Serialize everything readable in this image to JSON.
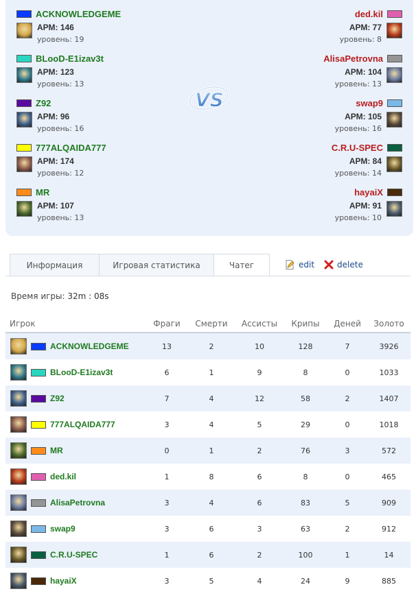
{
  "team_left": [
    {
      "name": "ACKNOWLEDGEME",
      "color": "#0a3cff",
      "apm": "АРМ: 146",
      "level": "уровень: 19",
      "avatar_color": "#d4a84a",
      "avatar_icon": "hero-portrait-icon"
    },
    {
      "name": "BLooD-E1izav3t",
      "color": "#2ad6c0",
      "apm": "АРМ: 123",
      "level": "уровень: 13",
      "avatar_color": "#2e7a8a",
      "avatar_icon": "hero-portrait-icon"
    },
    {
      "name": "Z92",
      "color": "#5a0aa0",
      "apm": "АРМ: 96",
      "level": "уровень: 16",
      "avatar_color": "#3d5f8a",
      "avatar_icon": "hero-portrait-icon"
    },
    {
      "name": "777ALQAIDA777",
      "color": "#ffff00",
      "apm": "АРМ: 174",
      "level": "уровень: 12",
      "avatar_color": "#8a5a4a",
      "avatar_icon": "hero-portrait-icon"
    },
    {
      "name": "MR",
      "color": "#ff8c1a",
      "apm": "АРМ: 107",
      "level": "уровень: 13",
      "avatar_color": "#4a6a2a",
      "avatar_icon": "hero-portrait-icon"
    }
  ],
  "team_right": [
    {
      "name": "ded.kil",
      "color": "#e060b0",
      "apm": "АРМ: 77",
      "level": "уровень: 8",
      "avatar_color": "#b83a1a",
      "avatar_icon": "hero-portrait-icon"
    },
    {
      "name": "AlisaPetrovna",
      "color": "#959595",
      "apm": "АРМ: 104",
      "level": "уровень: 13",
      "avatar_color": "#6a7aa0",
      "avatar_icon": "hero-portrait-icon"
    },
    {
      "name": "swap9",
      "color": "#7ab8e8",
      "apm": "АРМ: 105",
      "level": "уровень: 16",
      "avatar_color": "#5a4a3a",
      "avatar_icon": "hero-portrait-icon"
    },
    {
      "name": "C.R.U-SPEC",
      "color": "#0a6040",
      "apm": "АРМ: 84",
      "level": "уровень: 14",
      "avatar_color": "#6a5a2a",
      "avatar_icon": "hero-portrait-icon"
    },
    {
      "name": "hayaiX",
      "color": "#4a2a0a",
      "apm": "АРМ: 91",
      "level": "уровень: 10",
      "avatar_color": "#4a5a6a",
      "avatar_icon": "hero-portrait-icon"
    }
  ],
  "vs_label": "VS",
  "tabs": [
    {
      "label": "Информация"
    },
    {
      "label": "Игровая статистика"
    },
    {
      "label": "Чатег"
    }
  ],
  "actions": {
    "edit": "edit",
    "delete": "delete"
  },
  "game_time": {
    "label": "Время игры:",
    "value": "32m : 08s"
  },
  "table": {
    "headers": [
      "Игрок",
      "Фраги",
      "Смерти",
      "Ассисты",
      "Крипы",
      "Деней",
      "Золото"
    ],
    "rows": [
      {
        "name": "ACKNOWLEDGEME",
        "color": "#0a3cff",
        "avatar_color": "#d4a84a",
        "cells": [
          "13",
          "2",
          "10",
          "128",
          "7",
          "3926"
        ]
      },
      {
        "name": "BLooD-E1izav3t",
        "color": "#2ad6c0",
        "avatar_color": "#2e7a8a",
        "cells": [
          "6",
          "1",
          "9",
          "8",
          "0",
          "1033"
        ]
      },
      {
        "name": "Z92",
        "color": "#5a0aa0",
        "avatar_color": "#3d5f8a",
        "cells": [
          "7",
          "4",
          "12",
          "58",
          "2",
          "1407"
        ]
      },
      {
        "name": "777ALQAIDA777",
        "color": "#ffff00",
        "avatar_color": "#8a5a4a",
        "cells": [
          "3",
          "4",
          "5",
          "29",
          "0",
          "1018"
        ]
      },
      {
        "name": "MR",
        "color": "#ff8c1a",
        "avatar_color": "#4a6a2a",
        "cells": [
          "0",
          "1",
          "2",
          "76",
          "3",
          "572"
        ]
      },
      {
        "name": "ded.kil",
        "color": "#e060b0",
        "avatar_color": "#b83a1a",
        "cells": [
          "1",
          "8",
          "6",
          "8",
          "0",
          "465"
        ]
      },
      {
        "name": "AlisaPetrovna",
        "color": "#959595",
        "avatar_color": "#6a7aa0",
        "cells": [
          "3",
          "4",
          "6",
          "83",
          "5",
          "909"
        ]
      },
      {
        "name": "swap9",
        "color": "#7ab8e8",
        "avatar_color": "#5a4a3a",
        "cells": [
          "3",
          "6",
          "3",
          "63",
          "2",
          "912"
        ]
      },
      {
        "name": "C.R.U-SPEC",
        "color": "#0a6040",
        "avatar_color": "#6a5a2a",
        "cells": [
          "1",
          "6",
          "2",
          "100",
          "1",
          "14"
        ]
      },
      {
        "name": "hayaiX",
        "color": "#4a2a0a",
        "avatar_color": "#4a5a6a",
        "cells": [
          "3",
          "5",
          "4",
          "24",
          "9",
          "885"
        ]
      }
    ]
  }
}
